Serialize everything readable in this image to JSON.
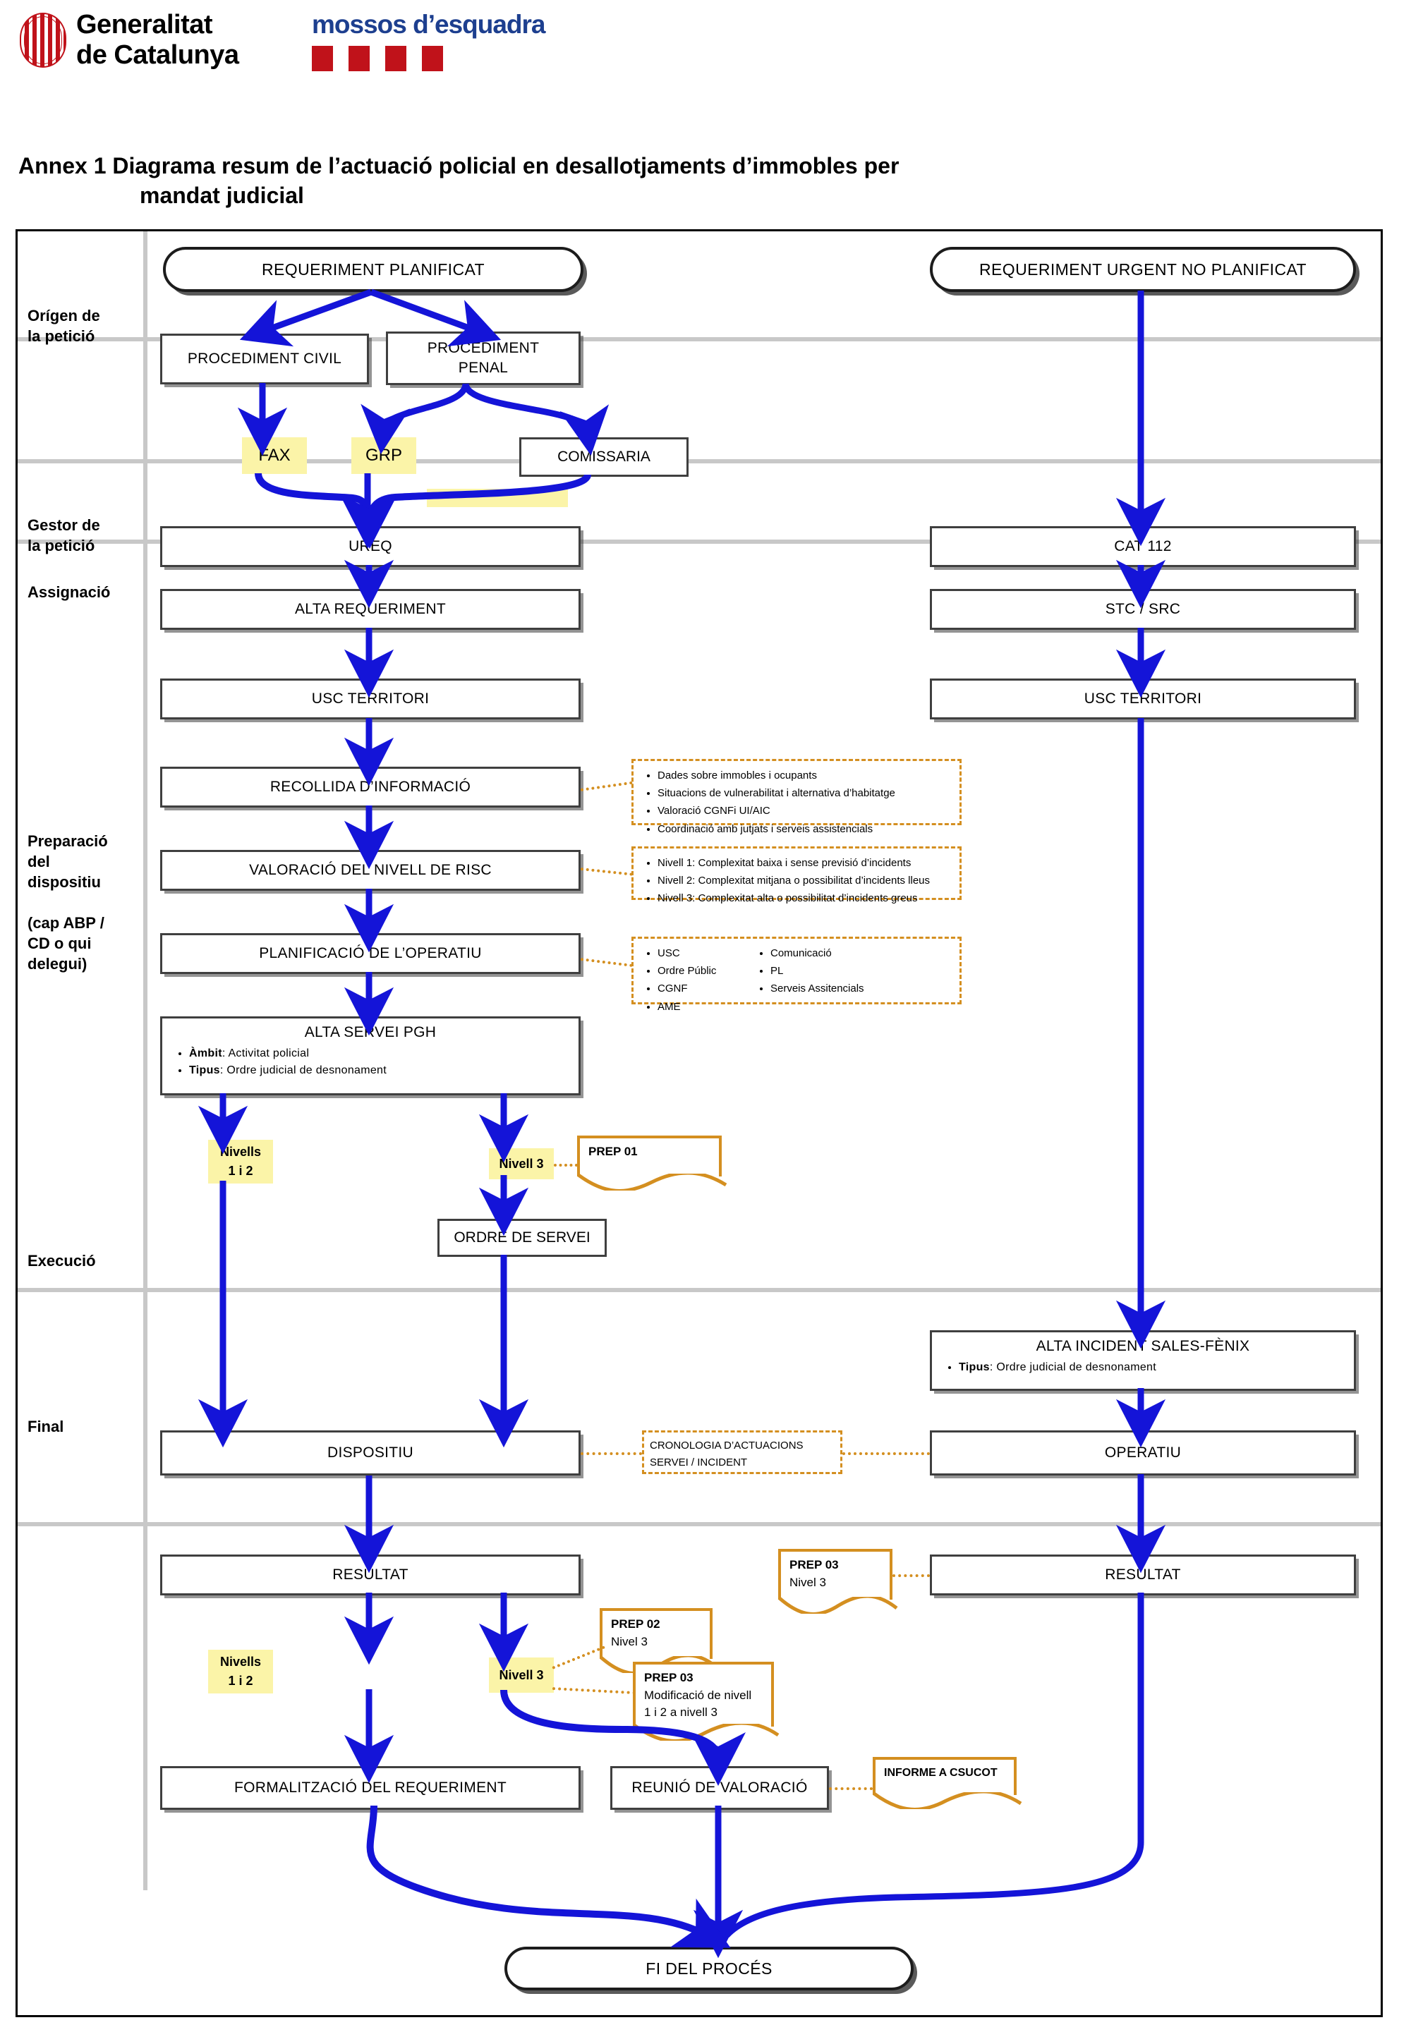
{
  "header": {
    "gencat_logo_text": "Generalitat\nde Catalunya",
    "mossos_logo_text": "mossos d’esquadra",
    "brand_red": "#c0121a",
    "brand_blue": "#1d3f8f"
  },
  "title": {
    "line1": "Annex 1 Diagrama resum de l’actuació policial en desallotjaments d’immobles per",
    "line2": "mandat judicial"
  },
  "lanes": [
    {
      "id": "origen",
      "label": "Orígen de\nla petició"
    },
    {
      "id": "gestor",
      "label": "Gestor de\nla petició"
    },
    {
      "id": "assignacio",
      "label": "Assignació"
    },
    {
      "id": "preparacio",
      "label": "Preparació\ndel\ndispositiu\n\n(cap ABP /\nCD o qui\ndelegui)"
    },
    {
      "id": "execucio",
      "label": "Execució"
    },
    {
      "id": "final",
      "label": "Final"
    }
  ],
  "nodes": {
    "requeriment_planificat": "REQUERIMENT PLANIFICAT",
    "requeriment_urgent": "REQUERIMENT URGENT NO PLANIFICAT",
    "procediment_civil": "PROCEDIMENT CIVIL",
    "procediment_penal": "PROCEDIMENT\nPENAL",
    "fax": "FAX",
    "grp": "GRP",
    "comissaria": "COMISSARIA",
    "obscured_note": "",
    "ureq": "UREQ",
    "alta_requeriment": "ALTA REQUERIMENT",
    "cat112": "CAT 112",
    "stc_src": "STC / SRC",
    "usc_territori_left": "USC TERRITORI",
    "usc_territori_right": "USC TERRITORI",
    "recollida": "RECOLLIDA D’INFORMACIÓ",
    "valoracio_risc": "VALORACIÓ DEL NIVELL DE RISC",
    "planificacio": "PLANIFICACIÓ DE L’OPERATIU",
    "alta_servei_pgh": {
      "title": "ALTA SERVEI PGH",
      "bullets": [
        {
          "label": "Àmbit",
          "value": "Activitat policial"
        },
        {
          "label": "Tipus",
          "value": "Ordre judicial de desnonament"
        }
      ]
    },
    "ordre_de_servei": "ORDRE DE SERVEI",
    "alta_incident_fenix": {
      "title": "ALTA INCIDENT SALES-FÈNIX",
      "bullets": [
        {
          "label": "Tipus",
          "value": "Ordre judicial de desnonament"
        }
      ]
    },
    "dispositiu": "DISPOSITIU",
    "operatiu": "OPERATIU",
    "resultat_left": "RESULTAT",
    "resultat_right": "RESULTAT",
    "formalitzacio": "FORMALITZACIÓ DEL REQUERIMENT",
    "reunio_valoracio": "REUNIÓ DE VALORACIÓ",
    "fi_proces": "FI DEL PROCÉS"
  },
  "highlights": {
    "nivells_1i2_prep": "Nivells\n1 i 2",
    "nivell3_prep": "Nivell 3",
    "nivells_1i2_final": "Nivells\n1 i 2",
    "nivell3_final": "Nivell 3"
  },
  "annotations": {
    "recollida_note": [
      "Dades sobre immobles i ocupants",
      "Situacions de vulnerabilitat i alternativa d’habitatge",
      "Valoració CGNFi UI/AIC",
      "Coordinació amb jutjats i serveis assistencials"
    ],
    "risc_note": [
      "Nivell 1: Complexitat baixa i sense previsió d’incidents",
      "Nivell 2: Complexitat mitjana o possibilitat d’incidents lleus",
      "Nivell 3: Complexitat alta o possibilitat d’incidents greus"
    ],
    "operatiu_note_col1": [
      "USC",
      "Ordre Públic",
      "CGNF",
      "AME"
    ],
    "operatiu_note_col2": [
      "Comunicació",
      "PL",
      "Serveis Assitencials"
    ],
    "cronologia_note": "CRONOLOGIA D’ACTUACIONS\nSERVEI / INCIDENT"
  },
  "documents": {
    "prep01": {
      "title": "PREP 01",
      "sub": ""
    },
    "prep02": {
      "title": "PREP 02",
      "sub": "Nivel 3"
    },
    "prep03_final": {
      "title": "PREP 03",
      "sub": "Modificació de nivell\n1 i 2 a nivell 3"
    },
    "prep03_right": {
      "title": "PREP 03",
      "sub": "Nivel 3"
    },
    "informe_csucot": {
      "title": "INFORME A CSUCOT",
      "sub": ""
    }
  },
  "colors": {
    "arrow_blue": "#1414d8",
    "note_orange": "#d48f20",
    "highlight_yellow": "#fbf4a8",
    "node_border": "#3f3f3f",
    "lane_line": "#c8c8c8"
  }
}
